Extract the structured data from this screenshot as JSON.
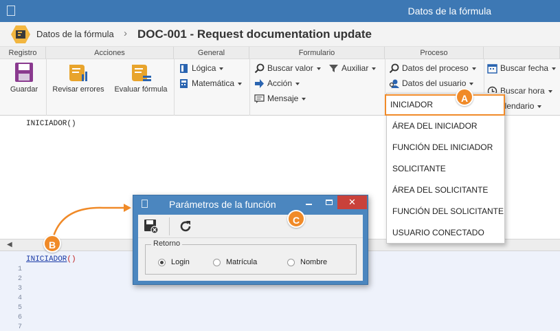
{
  "window": {
    "title": "Datos de la fórmula"
  },
  "header": {
    "crumb": "Datos de la fórmula",
    "separator": "›",
    "document": "DOC-001 - Request documentation update"
  },
  "ribbon": {
    "groups": {
      "registro": "Registro",
      "acciones": "Acciones",
      "general": "General",
      "formulario": "Formulario",
      "proceso": "Proceso"
    },
    "buttons": {
      "guardar": "Guardar",
      "revisar_errores": "Revisar errores",
      "evaluar_formula": "Evaluar fórmula",
      "logica": "Lógica",
      "matematica": "Matemática",
      "buscar_valor": "Buscar valor",
      "auxiliar": "Auxiliar",
      "accion": "Acción",
      "mensaje": "Mensaje",
      "datos_proceso": "Datos del proceso",
      "datos_usuario": "Datos del usuario",
      "buscar_fecha": "Buscar fecha",
      "buscar_hora": "Buscar hora",
      "calendario": "alendario"
    }
  },
  "editor": {
    "top_text": "INICIADOR()",
    "bottom_fn": "INICIADOR",
    "bottom_paren": "()",
    "line_numbers": [
      "1",
      "2",
      "3",
      "4",
      "5",
      "6",
      "7"
    ]
  },
  "dropdown": {
    "items": [
      "INICIADOR",
      "ÁREA DEL INICIADOR",
      "FUNCIÓN DEL INICIADOR",
      "SOLICITANTE",
      "ÁREA DEL SOLICITANTE",
      "FUNCIÓN DEL SOLICITANTE",
      "USUARIO CONECTADO"
    ],
    "selected": "INICIADOR"
  },
  "dialog": {
    "title": "Parámetros de la función",
    "close": "✕",
    "legend": "Retorno",
    "options": [
      "Login",
      "Matrícula",
      "Nombre"
    ],
    "selected": "Login"
  },
  "callouts": {
    "a": "A",
    "b": "B",
    "c": "C"
  },
  "colors": {
    "titlebar": "#3d78b4",
    "accent": "#f08a28",
    "close": "#c9413a"
  }
}
